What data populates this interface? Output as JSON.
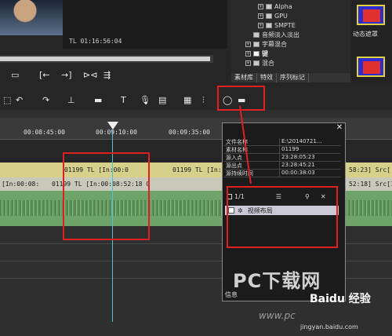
{
  "preview": {
    "timecode": "TL 01:16:56:04"
  },
  "tree": {
    "items": [
      {
        "label": "Alpha"
      },
      {
        "label": "GPU"
      },
      {
        "label": "SMPTE"
      },
      {
        "label": "音频淡入淡出"
      },
      {
        "label": "字幕混合"
      },
      {
        "label": "键"
      },
      {
        "label": "混合"
      }
    ]
  },
  "tabs": [
    "素材库",
    "特效",
    "序列标记"
  ],
  "right_panel": {
    "label": "动态遮罩"
  },
  "ruler": {
    "ticks": [
      "00:08:45:00",
      "00:09:10:00",
      "00:09:35:00"
    ]
  },
  "tracks": {
    "clip1": "01199  TL [In:00:0",
    "clip1_full": "01199  TL [In:00:08:52:18 O",
    "clip2": "01199  TL [In:",
    "clip_left": "[In:00:08:",
    "clip_right1": "58:23]  Src[",
    "clip_right2": "52:18]  Src[In"
  },
  "dialog": {
    "rows": [
      {
        "k": "文件名称",
        "v": "E:\\20140721..."
      },
      {
        "k": "素材名称",
        "v": "01199"
      },
      {
        "k": "源入点",
        "v": "23:28:05:23"
      },
      {
        "k": "源出点",
        "v": "23:28:45:21"
      },
      {
        "k": "源持续时间",
        "v": "00:00:38:03"
      }
    ],
    "page": "1/1",
    "item_label": "视频布局",
    "footer_label": "信息"
  },
  "watermark": {
    "text1": "PC下载网",
    "text2": "Baidu 经验",
    "text3": "jingyan.baidu.com",
    "text4": "www.pc"
  }
}
